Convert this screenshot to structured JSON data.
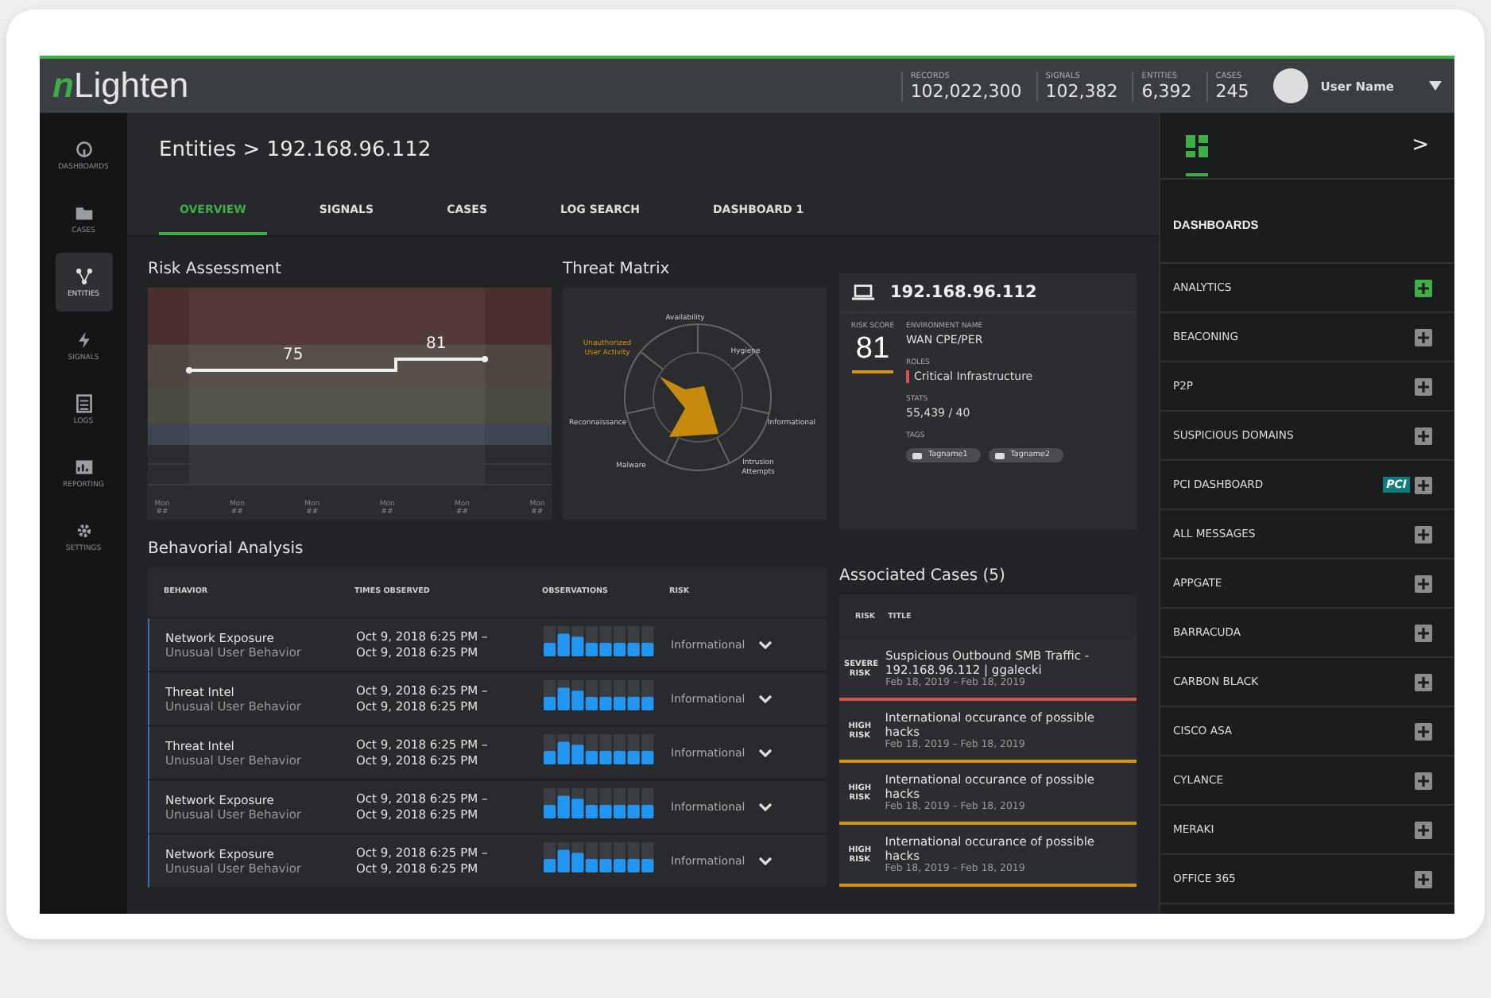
{
  "brand": {
    "logo_mark": "n",
    "logo": "Lighten"
  },
  "stats": [
    {
      "label": "RECORDS",
      "value": "102,022,300"
    },
    {
      "label": "SIGNALS",
      "value": "102,382"
    },
    {
      "label": "ENTITIES",
      "value": "6,392"
    },
    {
      "label": "CASES",
      "value": "245"
    }
  ],
  "user": {
    "name": "User Name"
  },
  "nav": [
    {
      "label": "DASHBOARDS",
      "kind": "gauge",
      "selected": false
    },
    {
      "label": "CASES",
      "kind": "folder",
      "selected": false
    },
    {
      "label": "ENTITIES",
      "kind": "nodes",
      "selected": true
    },
    {
      "label": "SIGNALS",
      "kind": "bolt",
      "selected": false
    },
    {
      "label": "LOGS",
      "kind": "list",
      "selected": false
    },
    {
      "label": "REPORTING",
      "kind": "chart",
      "selected": false
    },
    {
      "label": "SETTINGS",
      "kind": "gear",
      "selected": false
    }
  ],
  "page": {
    "breadcrumb": "Entities > 192.168.96.112"
  },
  "tabs": [
    {
      "label": "OVERVIEW",
      "selected": true
    },
    {
      "label": "SIGNALS",
      "selected": false
    },
    {
      "label": "CASES",
      "selected": false
    },
    {
      "label": "LOG SEARCH",
      "selected": false
    },
    {
      "label": "DASHBOARD 1",
      "selected": false
    }
  ],
  "risk_assessment": {
    "title": "Risk Assessment",
    "segment_labels": [
      "75",
      "81"
    ],
    "x_labels": [
      "Mon ##",
      "Mon ##",
      "Mon ##",
      "Mon ##",
      "Mon ##",
      "Mon ##"
    ]
  },
  "threat_matrix": {
    "title": "Threat Matrix",
    "axes": [
      {
        "label": "Availability",
        "highlighted": false
      },
      {
        "label": "Unauthorized User Activity",
        "highlighted": true
      },
      {
        "label": "Hygiene",
        "highlighted": false
      },
      {
        "label": "Reconnaissance",
        "highlighted": false
      },
      {
        "label": "Informational",
        "highlighted": false
      },
      {
        "label": "Malware",
        "highlighted": false
      },
      {
        "label": "Intrusion Attempts",
        "highlighted": false
      }
    ]
  },
  "entity": {
    "name": "192.168.96.112",
    "risk_label": "RISK SCORE",
    "risk_score": "81",
    "fields": [
      {
        "label": "ENVIRONMENT NAME",
        "value": "WAN CPE/PER",
        "kind": "plain"
      },
      {
        "label": "ROLES",
        "value": "Critical Infrastructure",
        "kind": "role"
      },
      {
        "label": "STATS",
        "value": "55,439 / 40",
        "kind": "plain"
      }
    ],
    "tags_label": "TAGS",
    "tags": [
      "Tagname1",
      "Tagname2"
    ]
  },
  "behavioral_analysis": {
    "title": "Behavorial Analysis",
    "columns": [
      "BEHAVIOR",
      "TIMES OBSERVED",
      "OBSERVATIONS",
      "RISK"
    ],
    "rows": [
      {
        "behavior": "Network Exposure",
        "category": "Unusual User Behavior",
        "start": "Oct 9, 2018 6:25 PM –",
        "end": "Oct 9, 2018 6:25 PM",
        "risk": "Informational"
      },
      {
        "behavior": "Threat Intel",
        "category": "Unusual User Behavior",
        "start": "Oct 9, 2018 6:25 PM –",
        "end": "Oct 9, 2018 6:25 PM",
        "risk": "Informational"
      },
      {
        "behavior": "Threat Intel",
        "category": "Unusual User Behavior",
        "start": "Oct 9, 2018 6:25 PM –",
        "end": "Oct 9, 2018 6:25 PM",
        "risk": "Informational"
      },
      {
        "behavior": "Network Exposure",
        "category": "Unusual User Behavior",
        "start": "Oct 9, 2018 6:25 PM –",
        "end": "Oct 9, 2018 6:25 PM",
        "risk": "Informational"
      },
      {
        "behavior": "Network Exposure",
        "category": "Unusual User Behavior",
        "start": "Oct 9, 2018 6:25 PM –",
        "end": "Oct 9, 2018 6:25 PM",
        "risk": "Informational"
      }
    ]
  },
  "associated_cases": {
    "title": "Associated Cases (5)",
    "columns": [
      "RISK",
      "TITLE"
    ],
    "rows": [
      {
        "risk": "SEVERE RISK",
        "color": "#d9534f",
        "title": "Suspicious Outbound SMB Traffic - 192.168.96.112 | ggalecki",
        "dates": "Feb 18, 2019 – Feb 18, 2019"
      },
      {
        "risk": "HIGH RISK",
        "color": "#d4960f",
        "title": "International occurance of possible hacks",
        "dates": "Feb 18, 2019 – Feb 18, 2019"
      },
      {
        "risk": "HIGH RISK",
        "color": "#d4960f",
        "title": "International occurance of possible hacks",
        "dates": "Feb 18, 2019 – Feb 18, 2019"
      },
      {
        "risk": "HIGH RISK",
        "color": "#d4960f",
        "title": "International occurance of possible hacks",
        "dates": "Feb 18, 2019 – Feb 18, 2019"
      }
    ]
  },
  "dashboards_panel": {
    "collapse": ">",
    "title": "DASHBOARDS",
    "items": [
      {
        "label": "ANALYTICS",
        "added": true
      },
      {
        "label": "BEACONING",
        "added": false
      },
      {
        "label": "P2P",
        "added": false
      },
      {
        "label": "SUSPICIOUS DOMAINS",
        "added": false
      },
      {
        "label": "PCI DASHBOARD",
        "added": false,
        "badge": "PCI"
      },
      {
        "label": "ALL MESSAGES",
        "added": false
      },
      {
        "label": "APPGATE",
        "added": false
      },
      {
        "label": "BARRACUDA",
        "added": false
      },
      {
        "label": "CARBON BLACK",
        "added": false
      },
      {
        "label": "CISCO ASA",
        "added": false
      },
      {
        "label": "CYLANCE",
        "added": false
      },
      {
        "label": "MERAKI",
        "added": false
      },
      {
        "label": "OFFICE 365",
        "added": false
      }
    ]
  }
}
